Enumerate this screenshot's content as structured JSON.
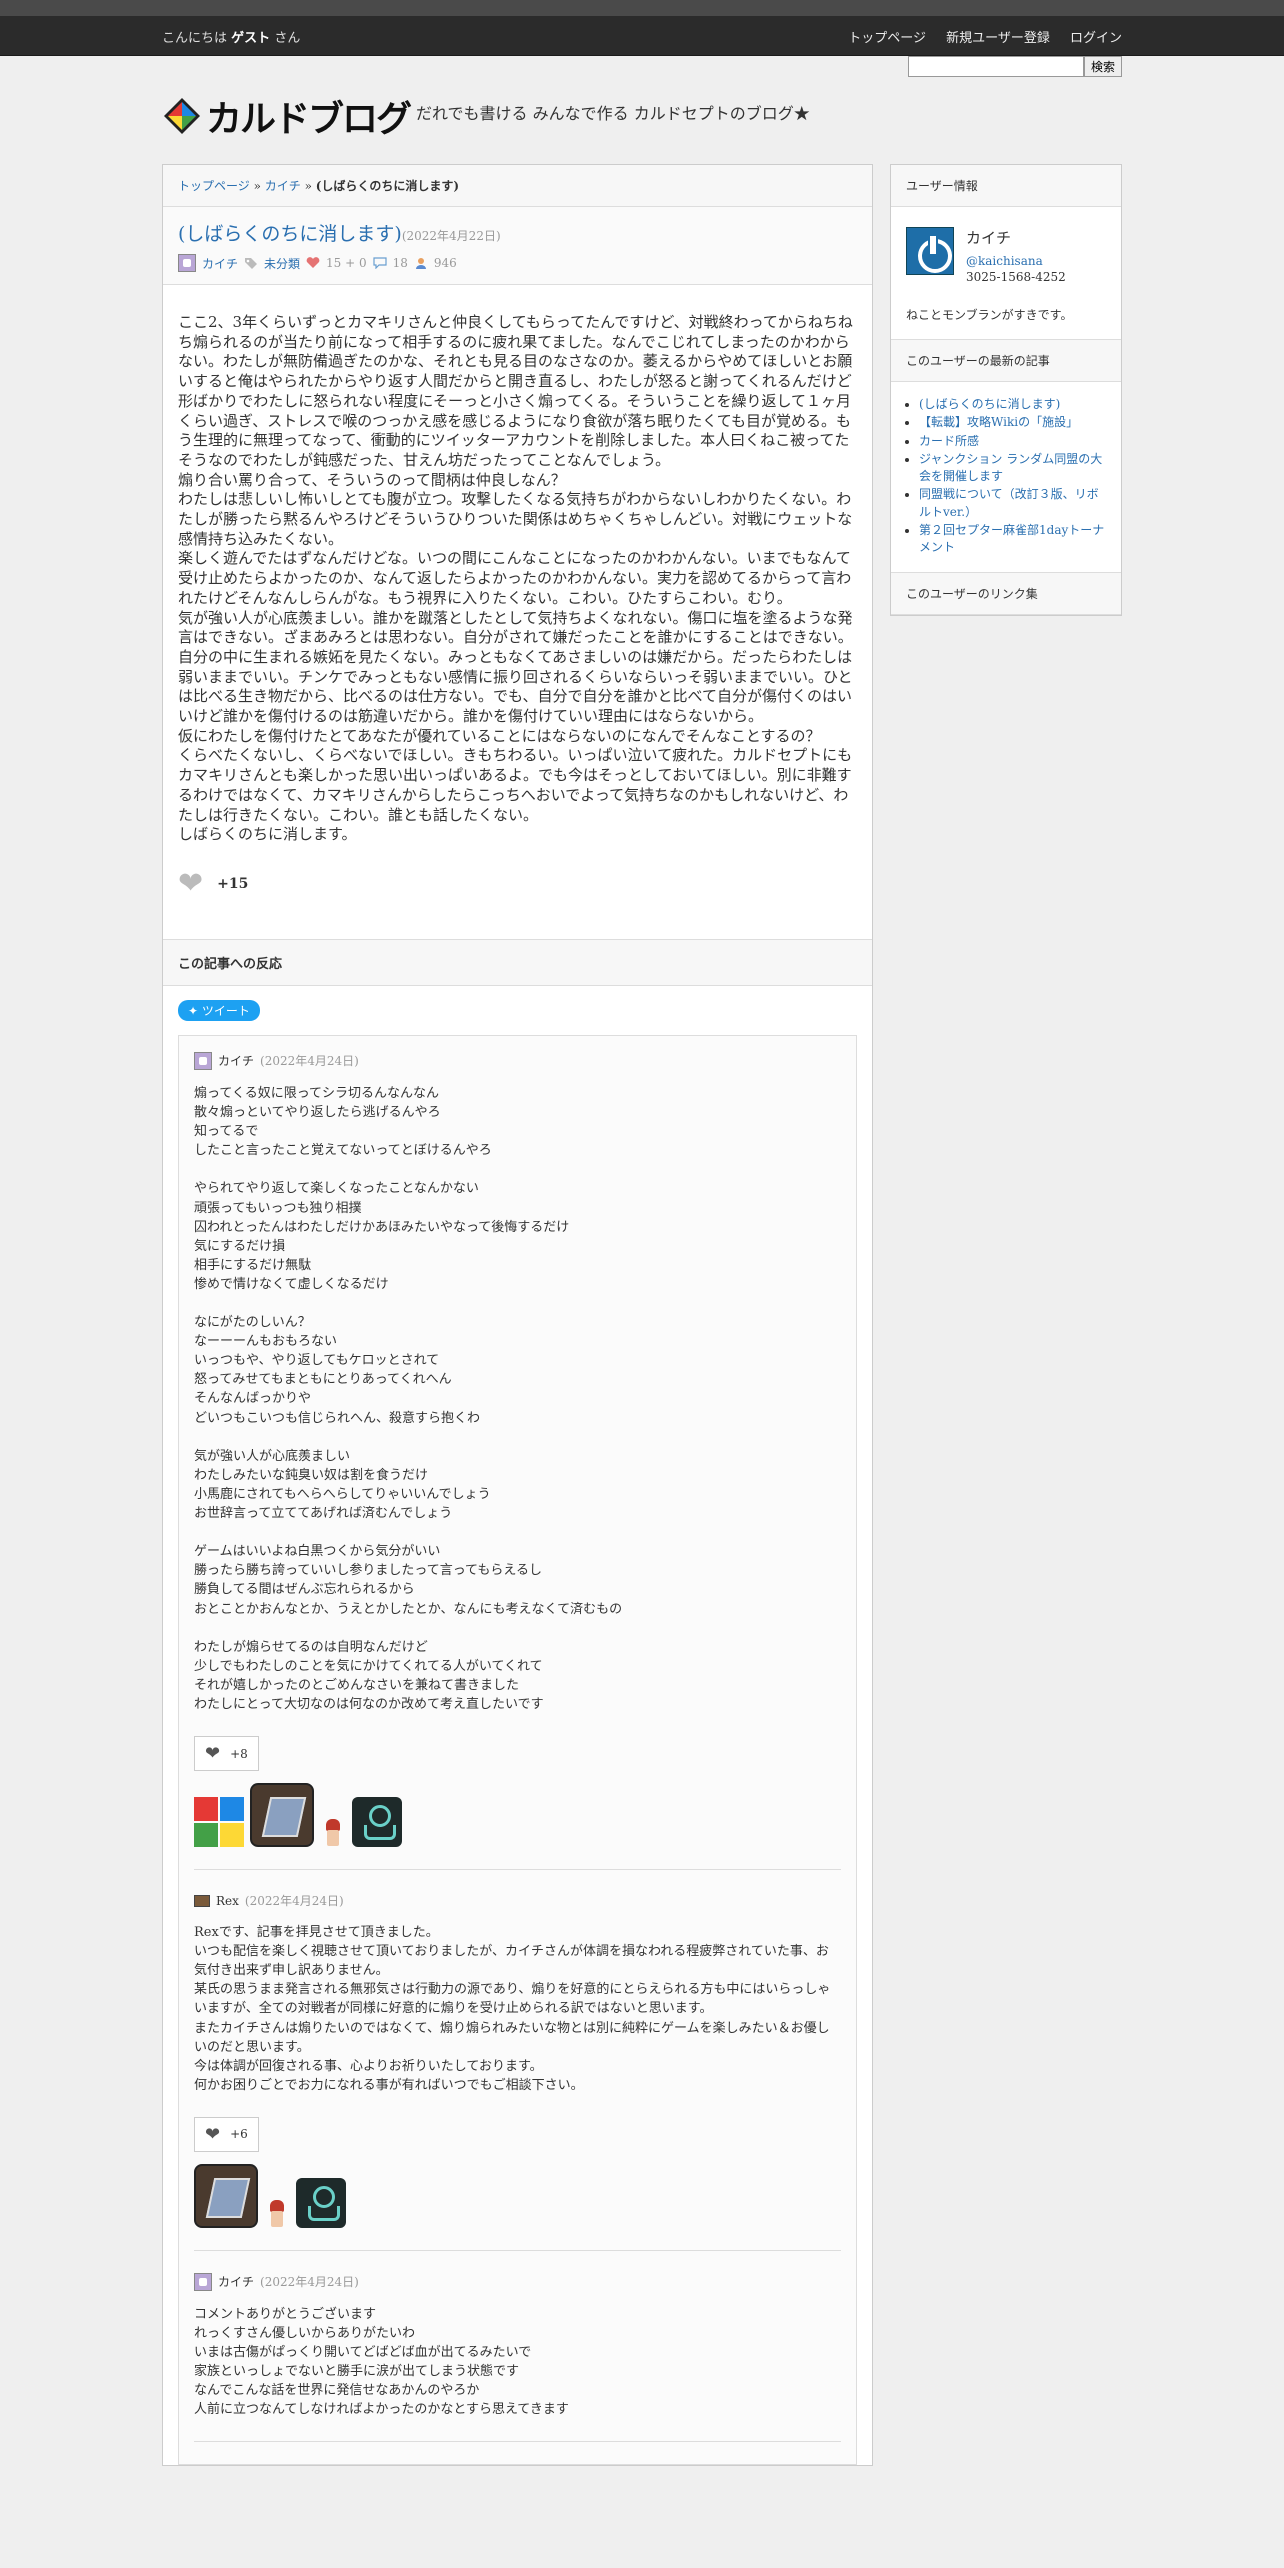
{
  "topbar": {
    "greeting_prefix": "こんにちは",
    "greeting_name": "ゲスト",
    "greeting_suffix": "さん",
    "nav": [
      "トップページ",
      "新規ユーザー登録",
      "ログイン"
    ]
  },
  "header": {
    "search_button": "検索",
    "logo_text": "カルドブログ",
    "tagline": "だれでも書ける みんなで作る カルドセプトのブログ★"
  },
  "breadcrumb": {
    "home": "トップページ",
    "user": "カイチ",
    "current": "(しばらくのちに消します)"
  },
  "article": {
    "title": "(しばらくのちに消します)",
    "date": "(2022年4月22日)",
    "author": "カイチ",
    "category": "未分類",
    "likes_meta": "15 + 0",
    "comments_meta": "18",
    "views_meta": "946",
    "paragraphs": [
      "ここ2、3年くらいずっとカマキリさんと仲良くしてもらってたんですけど、対戦終わってからねちねち煽られるのが当たり前になって相手するのに疲れ果てました。なんでこじれてしまったのかわからない。わたしが無防備過ぎたのかな、それとも見る目のなさなのか。萎えるからやめてほしいとお願いすると俺はやられたからやり返す人間だからと開き直るし、わたしが怒ると謝ってくれるんだけど形ばかりでわたしに怒られない程度にそーっと小さく煽ってくる。そういうことを繰り返して１ヶ月くらい過ぎ、ストレスで喉のつっかえ感を感じるようになり食欲が落ち眠りたくても目が覚める。もう生理的に無理ってなって、衝動的にツイッターアカウントを削除しました。本人曰くねこ被ってたそうなのでわたしが鈍感だった、甘えん坊だったってことなんでしょう。",
      "煽り合い罵り合って、そういうのって間柄は仲良しなん？",
      "わたしは悲しいし怖いしとても腹が立つ。攻撃したくなる気持ちがわからないしわかりたくない。わたしが勝ったら黙るんやろけどそういうひりついた関係はめちゃくちゃしんどい。対戦にウェットな感情持ち込みたくない。",
      "楽しく遊んでたはずなんだけどな。いつの間にこんなことになったのかわかんない。いまでもなんて受け止めたらよかったのか、なんて返したらよかったのかわかんない。実力を認めてるからって言われたけどそんなんしらんがな。もう視界に入りたくない。こわい。ひたすらこわい。むり。",
      "気が強い人が心底羨ましい。誰かを蹴落としたとして気持ちよくなれない。傷口に塩を塗るような発言はできない。ざまあみろとは思わない。自分がされて嫌だったことを誰かにすることはできない。自分の中に生まれる嫉妬を見たくない。みっともなくてあさましいのは嫌だから。だったらわたしは弱いままでいい。チンケでみっともない感情に振り回されるくらいならいっそ弱いままでいい。ひとは比べる生き物だから、比べるのは仕方ない。でも、自分で自分を誰かと比べて自分が傷付くのはいいけど誰かを傷付けるのは筋違いだから。誰かを傷付けていい理由にはならないから。",
      "仮にわたしを傷付けたとてあなたが優れていることにはならないのになんでそんなことするの？",
      "くらべたくないし、くらべないでほしい。きもちわるい。いっぱい泣いて疲れた。カルドセプトにもカマキリさんとも楽しかった思い出いっぱいあるよ。でも今はそっとしておいてほしい。別に非難するわけではなくて、カマキリさんからしたらこっちへおいでよって気持ちなのかもしれないけど、わたしは行きたくない。こわい。誰とも話したくない。",
      "しばらくのちに消します。"
    ],
    "like_count": "+15"
  },
  "reactions": {
    "header": "この記事への反応",
    "tweet_label": "ツイート",
    "comments": [
      {
        "author": "カイチ",
        "date": "(2022年4月24日)",
        "lines": [
          "煽ってくる奴に限ってシラ切るんなんなん",
          "散々煽っといてやり返したら逃げるんやろ",
          "知ってるで",
          "したこと言ったこと覚えてないってとぼけるんやろ",
          "",
          "やられてやり返して楽しくなったことなんかない",
          "頑張ってもいっつも独り相撲",
          "囚われとったんはわたしだけかあほみたいやなって後悔するだけ",
          "気にするだけ損",
          "相手にするだけ無駄",
          "惨めで情けなくて虚しくなるだけ",
          "",
          "なにがたのしいん？",
          "なーーーんもおもろない",
          "いっつもや、やり返してもケロッとされて",
          "怒ってみせてもまともにとりあってくれへん",
          "そんなんばっかりや",
          "どいつもこいつも信じられへん、殺意すら抱くわ",
          "",
          "気が強い人が心底羨ましい",
          "わたしみたいな鈍臭い奴は割を食うだけ",
          "小馬鹿にされてもへらへらしてりゃいいんでしょう",
          "お世辞言って立ててあげれば済むんでしょう",
          "",
          "ゲームはいいよね白黒つくから気分がいい",
          "勝ったら勝ち誇っていいし参りましたって言ってもらえるし",
          "勝負してる間はぜんぶ忘れられるから",
          "おとことかおんなとか、うえとかしたとか、なんにも考えなくて済むもの",
          "",
          "わたしが煽らせてるのは自明なんだけど",
          "少しでもわたしのことを気にかけてくれてる人がいてくれて",
          "それが嬉しかったのとごめんなさいを兼ねて書きました",
          "わたしにとって大切なのは何なのか改めて考え直したいです"
        ],
        "like_count": "+8",
        "reactors": [
          "quad",
          "dark",
          "sprite",
          "teal"
        ]
      },
      {
        "author": "Rex",
        "date": "(2022年4月24日)",
        "lines": [
          "Rexです、記事を拝見させて頂きました。",
          "いつも配信を楽しく視聴させて頂いておりましたが、カイチさんが体調を損なわれる程疲弊されていた事、お気付き出来ず申し訳ありません。",
          "某氏の思うまま発言される無邪気さは行動力の源であり、煽りを好意的にとらえられる方も中にはいらっしゃいますが、全ての対戦者が同様に好意的に煽りを受け止められる訳ではないと思います。",
          "またカイチさんは煽りたいのではなくて、煽り煽られみたいな物とは別に純粋にゲームを楽しみたい＆お優しいのだと思います。",
          "今は体調が回復される事、心よりお祈りいたしております。",
          "何かお困りごとでお力になれる事が有ればいつでもご相談下さい。"
        ],
        "like_count": "+6",
        "reactors": [
          "dark",
          "sprite",
          "teal"
        ]
      },
      {
        "author": "カイチ",
        "date": "(2022年4月24日)",
        "lines": [
          "コメントありがとうございます",
          "れっくすさん優しいからありがたいわ",
          "いまは古傷がぱっくり開いてどばどば血が出てるみたいで",
          "家族といっしょでないと勝手に涙が出てしまう状態です",
          "なんでこんな話を世界に発信せなあかんのやろか",
          "人前に立つなんてしなければよかったのかなとすら思えてきます"
        ]
      }
    ]
  },
  "sidebar": {
    "user_info_header": "ユーザー情報",
    "user_name": "カイチ",
    "user_handle": "@kaichisana",
    "user_id": "3025-1568-4252",
    "user_bio": "ねことモンブランがすきです。",
    "recent_header": "このユーザーの最新の記事",
    "recent_articles": [
      "(しばらくのちに消します)",
      "【転載】攻略Wikiの「施設」",
      "カード所感",
      "ジャンクション ランダム同盟の大会を開催します",
      "同盟戦について（改訂３版、リボルトver.）",
      "第２回セプター麻雀部1dayトーナメント"
    ],
    "links_header": "このユーザーのリンク集"
  },
  "colors": {
    "link": "#2a6fb0",
    "topbar": "#2b2b2b",
    "tweet": "#1da1f2"
  }
}
